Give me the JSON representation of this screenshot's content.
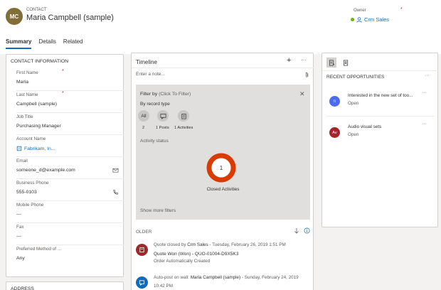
{
  "header": {
    "avatar_initials": "MC",
    "avatar_color": "#826e39",
    "entity_type": "CONTACT",
    "record_name": "Maria Campbell (sample)",
    "owner_label": "Owner",
    "owner_required": "*",
    "owner_value": "Crm Sales"
  },
  "tabs": [
    {
      "label": "Summary",
      "active": true
    },
    {
      "label": "Details",
      "active": false
    },
    {
      "label": "Related",
      "active": false
    }
  ],
  "contact_info": {
    "title": "CONTACT INFORMATION",
    "fields": [
      {
        "label": "First Name",
        "required": "*",
        "value": "Maria"
      },
      {
        "label": "Last Name",
        "required": "*",
        "value": "Campbell (sample)"
      },
      {
        "label": "Job Title",
        "value": "Purchasing Manager"
      },
      {
        "label": "Account Name",
        "value": "Fabrikam, In..."
      },
      {
        "label": "Email",
        "value": "someone_d@example.com"
      },
      {
        "label": "Business Phone",
        "value": "555-0103"
      },
      {
        "label": "Mobile Phone",
        "value": "---"
      },
      {
        "label": "Fax",
        "value": "---"
      },
      {
        "label": "Preferred Method of ...",
        "value": "Any"
      }
    ]
  },
  "address": {
    "title": "ADDRESS"
  },
  "timeline": {
    "title": "Timeline",
    "add_symbol": "+",
    "more_symbol": "···",
    "note_placeholder": "Enter a note...",
    "filter": {
      "title": "Filter by",
      "subtitle": "(Click To Filter)",
      "by_record_type": "By record type",
      "chip_all": "All",
      "count_all": "2",
      "count_posts": "1 Posts",
      "count_activities": "1 Activities",
      "activity_status": "Activity status",
      "donut_value": "1",
      "donut_label": "Closed Activities",
      "show_more": "Show more filters"
    },
    "older_label": "OLDER",
    "items": [
      {
        "prefix": "Quote closed by",
        "who": "Crm Sales",
        "date": " - Tuesday, February 26, 2019 1:51 PM",
        "line2": "Quote Won (Won) - QUO-01004-D9X5K3",
        "line3": "Order Automatically Created"
      },
      {
        "prefix": "Auto-post on wall:",
        "who": "Maria Campbell (sample)",
        "date": " - Sunday, February 24, 2019",
        "line2": "10:42 PM",
        "line3": ""
      }
    ]
  },
  "opportunities": {
    "title": "RECENT OPPORTUNITIES",
    "more_symbol": "···",
    "items": [
      {
        "initials": "Ii",
        "color": "#4f6bed",
        "name": "Interested in the new set of too...",
        "status": "Open"
      },
      {
        "initials": "Av",
        "color": "#a4262c",
        "name": "Audio visual sets",
        "status": "Open"
      }
    ]
  },
  "colors": {
    "accent": "#0f6cbd",
    "donut": "#da3b01",
    "quote_icon": "#a4262c",
    "post_icon": "#0f6cbd"
  }
}
